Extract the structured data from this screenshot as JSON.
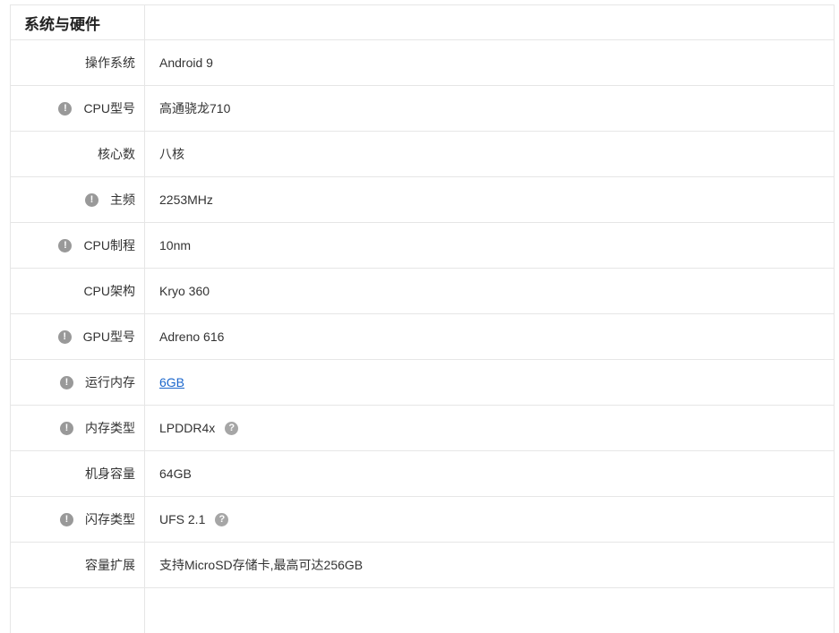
{
  "section": {
    "title": "系统与硬件"
  },
  "icons": {
    "warn": "!",
    "help": "?"
  },
  "colors": {
    "link": "#1a66cc",
    "border": "#e6e6e6",
    "icon": "#999999"
  },
  "rows": [
    {
      "label": "操作系统",
      "value": "Android 9"
    },
    {
      "label": "CPU型号",
      "value": "高通骁龙710"
    },
    {
      "label": "核心数",
      "value": "八核"
    },
    {
      "label": "主频",
      "value": "2253MHz"
    },
    {
      "label": "CPU制程",
      "value": "10nm"
    },
    {
      "label": "CPU架构",
      "value": "Kryo 360"
    },
    {
      "label": "GPU型号",
      "value": "Adreno 616"
    },
    {
      "label": "运行内存",
      "value": "6GB"
    },
    {
      "label": "内存类型",
      "value": "LPDDR4x"
    },
    {
      "label": "机身容量",
      "value": "64GB"
    },
    {
      "label": "闪存类型",
      "value": "UFS 2.1"
    },
    {
      "label": "容量扩展",
      "value": "支持MicroSD存储卡,最高可达256GB"
    }
  ]
}
